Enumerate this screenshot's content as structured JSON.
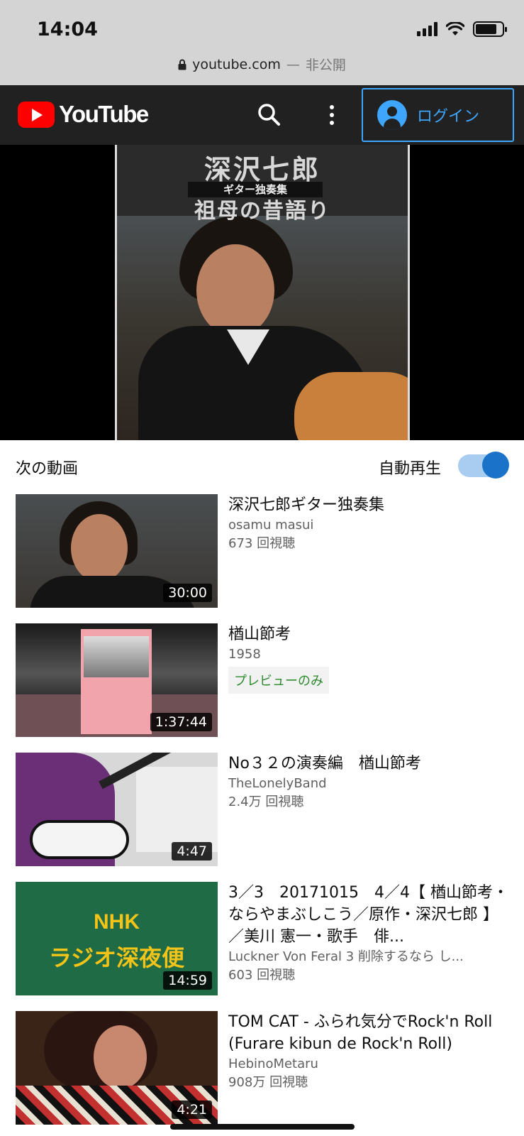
{
  "status_bar": {
    "time": "14:04",
    "battery_level": 0.8
  },
  "url_bar": {
    "domain": "youtube.com",
    "separator": "—",
    "privacy": "非公開"
  },
  "header": {
    "brand": "YouTube",
    "login_label": "ログイン"
  },
  "player": {
    "cover_title": "深沢七郎",
    "cover_band": "ギター独奏集",
    "cover_subtitle": "祖母の昔語り"
  },
  "up_next": {
    "label": "次の動画",
    "autoplay_label": "自動再生",
    "autoplay_on": true
  },
  "videos": [
    {
      "title": "深沢七郎ギター独奏集",
      "channel": "osamu masui",
      "views": "673 回視聴",
      "duration": "30:00"
    },
    {
      "title": "楢山節考",
      "channel": "1958",
      "badge": "プレビューのみ",
      "duration": "1:37:44"
    },
    {
      "title": "No３２の演奏編　楢山節考",
      "channel": "TheLonelyBand",
      "views": "2.4万 回視聴",
      "duration": "4:47"
    },
    {
      "title": "3／3　20171015　4／4【 楢山節考・ならやまぶしこう／原作・深沢七郎 】／美川 憲一・歌手　俳...",
      "channel": "Luckner Von Feral 3 削除するなら し...",
      "views": "603 回視聴",
      "duration": "14:59",
      "thumb_text_1": "NHK",
      "thumb_text_2": "ラジオ深夜便"
    },
    {
      "title": "TOM CAT - ふられ気分でRock'n Roll (Furare kibun de Rock'n Roll)",
      "channel": "HebinoMetaru",
      "views": "908万 回視聴",
      "duration": "4:21"
    }
  ]
}
